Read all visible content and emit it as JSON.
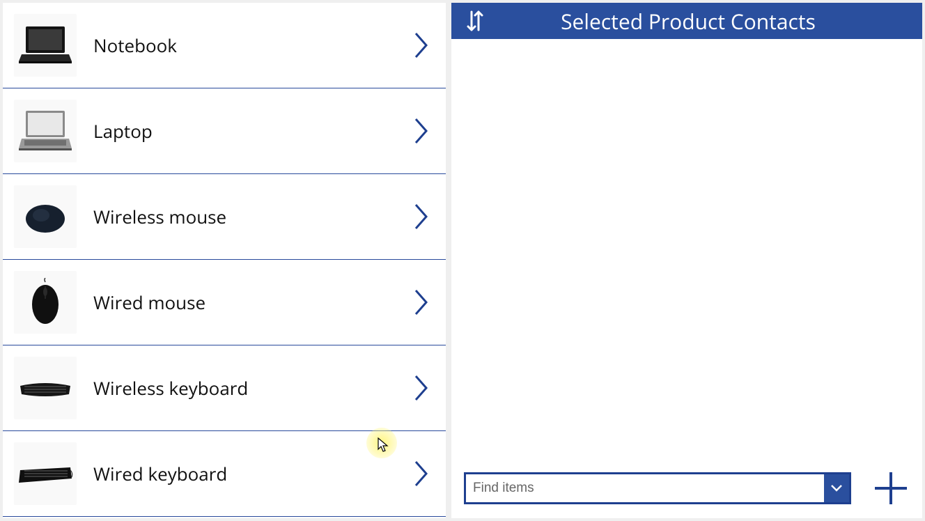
{
  "left": {
    "items": [
      {
        "label": "Notebook",
        "thumb": "notebook"
      },
      {
        "label": "Laptop",
        "thumb": "laptop"
      },
      {
        "label": "Wireless mouse",
        "thumb": "wireless-mouse"
      },
      {
        "label": "Wired mouse",
        "thumb": "wired-mouse"
      },
      {
        "label": "Wireless keyboard",
        "thumb": "keyboard-curved"
      },
      {
        "label": "Wired keyboard",
        "thumb": "keyboard-flat"
      }
    ]
  },
  "right": {
    "title": "Selected Product Contacts",
    "find_placeholder": "Find items"
  },
  "colors": {
    "accent": "#2a4f9e",
    "accent_border": "#1e3f8f"
  }
}
